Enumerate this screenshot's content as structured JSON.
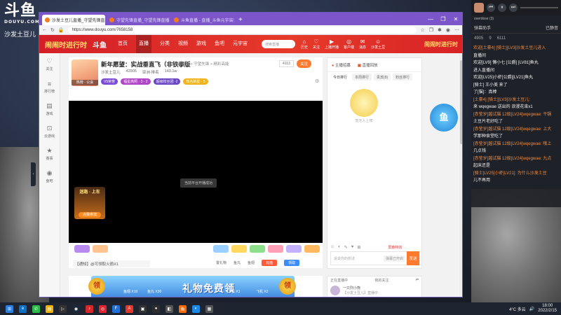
{
  "overlay": {
    "logo_main": "斗鱼",
    "logo_sub": "DOUYU.COM",
    "streamer_name": "沙发土豆儿"
  },
  "chat_overlay": {
    "song": "overdose (3)",
    "title": "弹幕助手",
    "status": "已静音",
    "stats": [
      "4905",
      "9",
      "6111"
    ],
    "lines": [
      {
        "text": "欢迎[土豪4] [骑士][LV3]沙发土豆儿进入",
        "color": "orange"
      },
      {
        "text": "直播间",
        "color": "white"
      },
      {
        "text": "欢迎[LV9] 懒小七 [公爵] [LV81]鱼丸",
        "color": "white"
      },
      {
        "text": "进入直播间",
        "color": "white"
      },
      {
        "text": "欢迎[LV25]小虾[公爵][LV21]鱼丸",
        "color": "white"
      },
      {
        "text": "[骑士] 王小美 来了",
        "color": "white"
      },
      {
        "text": "了[猫]：真棒",
        "color": "white"
      },
      {
        "text": "[土豪4] [骑士][LV3]沙发土豆儿:",
        "color": "orange"
      },
      {
        "text": "来 wqegwae 送出的 浪漫花束x1",
        "color": "white"
      },
      {
        "text": "[赤莹岁]越试猫 12级[LV24]wqegwae: 干锅",
        "color": "orange"
      },
      {
        "text": "土豆片老好吃了",
        "color": "white"
      },
      {
        "text": "[赤莹岁]越试猫 12级[LV24]wqegwae: 上大",
        "color": "orange"
      },
      {
        "text": "学那种食堂吃了",
        "color": "white"
      },
      {
        "text": "[赤莹岁]越试猫 12级[LV24]wqegwae: 哦上",
        "color": "orange"
      },
      {
        "text": "几点钱",
        "color": "white"
      },
      {
        "text": "[赤莹岁]越试猫 12级[LV24]wqegwae: 九点",
        "color": "orange"
      },
      {
        "text": "起床还是",
        "color": "white"
      },
      {
        "text": "[骑士]LV25]小虾[LV21]: 为什么沙发土豆",
        "color": "orange"
      },
      {
        "text": "儿不再用",
        "color": "white"
      }
    ]
  },
  "browser": {
    "tabs": [
      {
        "label": "沙发土豆儿直播_守望先锋直播...",
        "active": true
      },
      {
        "label": "守望先锋直播_守望先锋直播视频...",
        "active": false
      },
      {
        "label": "斗鱼直播 - 直播_斗鱼元宇宙音乐...",
        "active": false
      }
    ],
    "url": "https://www.douyu.com/7658158",
    "new_tab": "+",
    "controls": [
      "—",
      "❐",
      "✕"
    ]
  },
  "site": {
    "festival_logo": "闹闹时进行时",
    "brand": "斗鱼",
    "nav": [
      "首页",
      "直播",
      "分类",
      "视频",
      "游戏",
      "鱼吧",
      "元宇宙"
    ],
    "active_nav": "直播",
    "search_placeholder": "搜索直播",
    "header_icons": [
      {
        "icon": "⌂",
        "label": "历史"
      },
      {
        "icon": "♡",
        "label": "关注"
      },
      {
        "icon": "▶",
        "label": "上播开播"
      },
      {
        "icon": "◎",
        "label": "客户端"
      },
      {
        "icon": "✉",
        "label": "消息"
      },
      {
        "icon": "☺",
        "label": "沙发土豆"
      }
    ],
    "header_right": "闹闹时进行时"
  },
  "sidebar": [
    {
      "icon": "♡",
      "label": "关注"
    },
    {
      "icon": "≡",
      "label": "排行榜"
    },
    {
      "icon": "▤",
      "label": "游戏"
    },
    {
      "icon": "⊡",
      "label": "云游戏"
    },
    {
      "icon": "★",
      "label": "赛事"
    },
    {
      "icon": "◉",
      "label": "鱼吧"
    }
  ],
  "room": {
    "title": "新年愿望：实战垂直飞（非铁拳版",
    "category": "网游竞技 > 守望先锋 > 精彩高能",
    "streamer": "沙发土豆儿",
    "hot": "42905",
    "follow_count": "4113",
    "follow_btn": "关注",
    "avatar_badge": "热榜 · 公会",
    "meta_extra": [
      "亚洲·排名",
      "143.1w"
    ],
    "tags": [
      {
        "text": "V5荣誉",
        "color": "#7b4ad6"
      },
      {
        "text": "福星高照 · 3 · 2",
        "color": "#b045c7"
      },
      {
        "text": "超级粉丝团 ·2",
        "color": "#6b46c1"
      },
      {
        "text": "知名新星 · 5",
        "color": "#f2b318"
      }
    ]
  },
  "player": {
    "toast": "当前平台开播成功",
    "ad_title": "迷路 · 上车",
    "ad_button": "点我参加"
  },
  "gifts": {
    "notice": "【通知】@可领取火箭X1",
    "controls": [
      "置礼物",
      "鱼丸",
      "鱼翅"
    ],
    "buttons": [
      {
        "label": "充值",
        "color": "#ff5a3c"
      },
      {
        "label": "领取",
        "color": "#3c8bff"
      }
    ]
  },
  "banner": {
    "title": "礼物免费领",
    "coin": "领",
    "gifts": [
      "鱼翅 X10",
      "鱼丸 X30",
      "飞机 X1",
      "飞机 X2"
    ]
  },
  "right_panel": {
    "top": [
      "主播招募",
      "直播回放"
    ],
    "tabs": [
      "今日排行",
      "本周排行",
      "贵宾(8)",
      "粉丝排行"
    ],
    "empty_text": "暂无人上榜",
    "chat_placeholder": "说说你的想法",
    "check": "弹幕已开启",
    "send": "发送",
    "report": "屏蔽特效"
  },
  "lower_right": {
    "left": "正在直播中",
    "title": "我的关注",
    "item_name": "一只烈小熊",
    "item_sub": "【沙发土豆儿】直播中"
  },
  "taskbar": {
    "weather": "4°C 多云",
    "time": "18:00",
    "date": "2022/2/15"
  }
}
